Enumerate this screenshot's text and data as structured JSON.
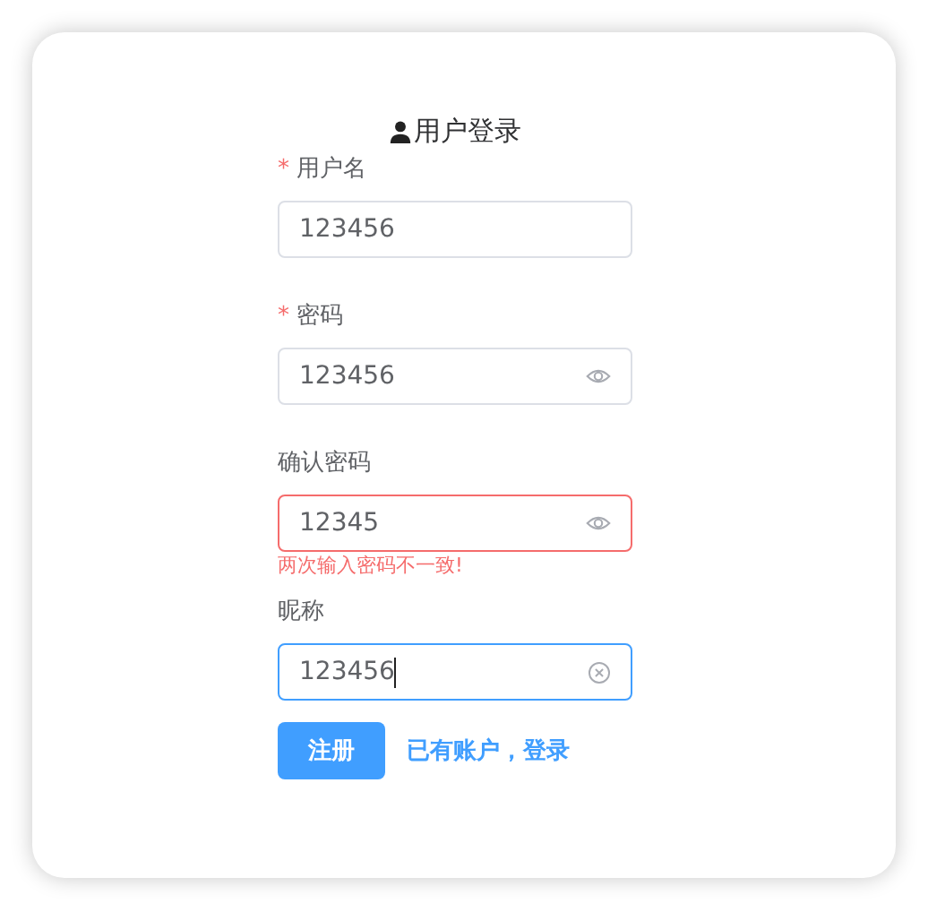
{
  "title": "用户登录",
  "fields": [
    {
      "label": "用户名",
      "required_mark": "*",
      "value": "123456",
      "kind": "text",
      "focused": false
    },
    {
      "label": "密码",
      "required_mark": "*",
      "value": "123456",
      "kind": "password",
      "focused": false
    },
    {
      "label": "确认密码",
      "value": "12345",
      "kind": "password",
      "focused": false,
      "error": "两次输入密码不一致!"
    },
    {
      "label": "昵称",
      "value": "123456",
      "kind": "clearable",
      "focused": true
    }
  ],
  "submit_button": "注册",
  "login_link": "已有账户，登录"
}
